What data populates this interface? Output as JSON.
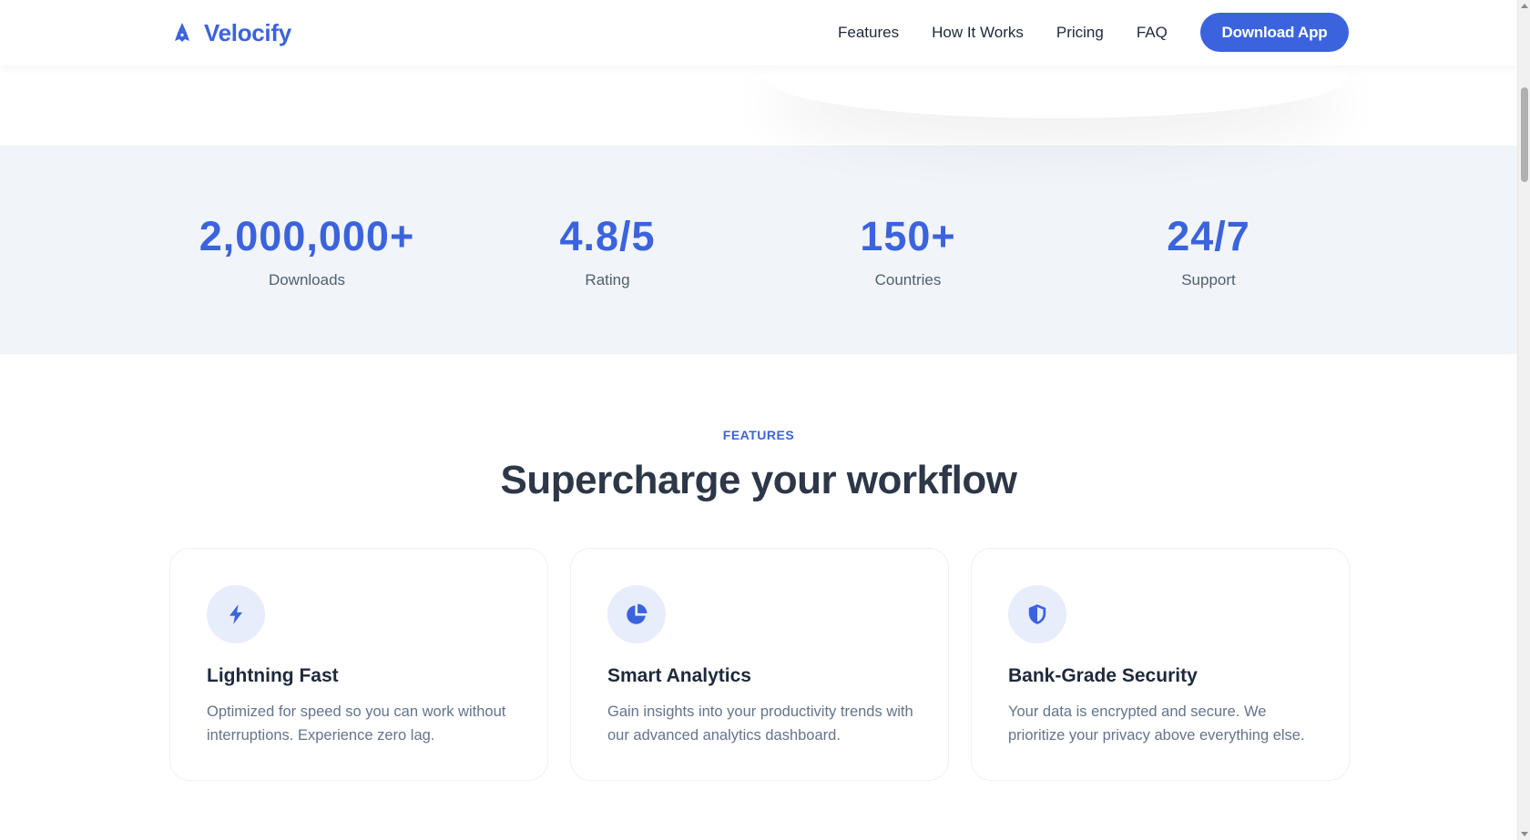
{
  "header": {
    "brand": "Velocify",
    "logo_icon": "rocket-icon",
    "nav": [
      {
        "label": "Features"
      },
      {
        "label": "How It Works"
      },
      {
        "label": "Pricing"
      },
      {
        "label": "FAQ"
      }
    ],
    "cta_label": "Download App"
  },
  "stats": [
    {
      "value": "2,000,000+",
      "label": "Downloads"
    },
    {
      "value": "4.8/5",
      "label": "Rating"
    },
    {
      "value": "150+",
      "label": "Countries"
    },
    {
      "value": "24/7",
      "label": "Support"
    }
  ],
  "features": {
    "eyebrow": "FEATURES",
    "title": "Supercharge your workflow",
    "cards": [
      {
        "icon": "lightning-bolt-icon",
        "title": "Lightning Fast",
        "description": "Optimized for speed so you can work without interruptions. Experience zero lag."
      },
      {
        "icon": "pie-chart-icon",
        "title": "Smart Analytics",
        "description": "Gain insights into your productivity trends with our advanced analytics dashboard."
      },
      {
        "icon": "shield-icon",
        "title": "Bank-Grade Security",
        "description": "Your data is encrypted and secure. We prioritize your privacy above everything else."
      }
    ]
  },
  "colors": {
    "accent": "#3b63dd",
    "stats_background": "#f1f4f9",
    "heading": "#2d3748",
    "muted_text": "#64748b",
    "icon_circle": "#e8edfb"
  }
}
